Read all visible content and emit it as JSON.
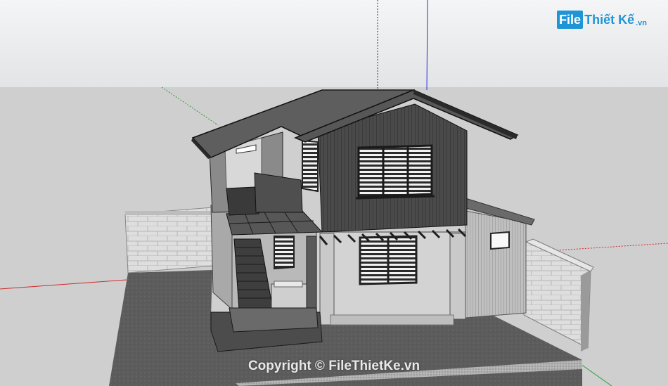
{
  "brand": {
    "logo_box": "File",
    "logo_text": "Thiết Kế",
    "logo_suffix": ".vn"
  },
  "watermark": "Copyright © FileThietKe.vn",
  "colors": {
    "sky": "#eceeef",
    "ground": "#cfcfcf",
    "pavement": "#5f5f5f",
    "roof": "#5b5b5b",
    "wall_dark": "#4b4b4b",
    "wall_light": "#d7d7d7",
    "brick": "#dadada",
    "accent_logo": "#1f95d6"
  }
}
